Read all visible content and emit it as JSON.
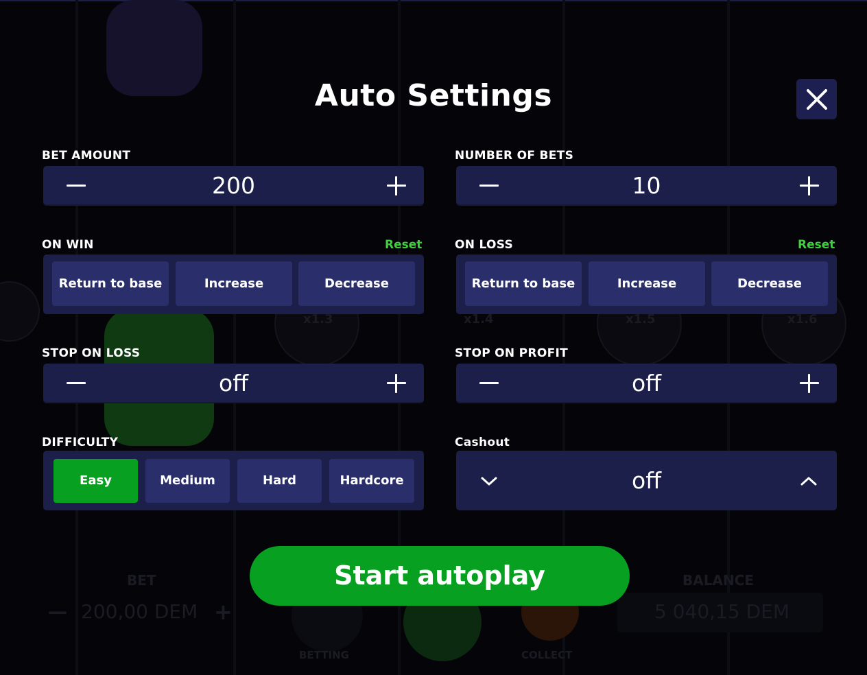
{
  "title": "Auto Settings",
  "bet_amount": {
    "label": "BET AMOUNT",
    "value": "200"
  },
  "number_of_bets": {
    "label": "NUMBER OF BETS",
    "value": "10"
  },
  "on_win": {
    "label": "ON WIN",
    "reset": "Reset",
    "options": [
      "Return to base",
      "Increase",
      "Decrease"
    ]
  },
  "on_loss": {
    "label": "ON LOSS",
    "reset": "Reset",
    "options": [
      "Return to base",
      "Increase",
      "Decrease"
    ]
  },
  "stop_on_loss": {
    "label": "STOP ON LOSS",
    "value": "off"
  },
  "stop_on_profit": {
    "label": "STOP ON PROFIT",
    "value": "off"
  },
  "difficulty": {
    "label": "DIFFICULTY",
    "options": [
      "Easy",
      "Medium",
      "Hard",
      "Hardcore"
    ],
    "selected": "Easy"
  },
  "cashout": {
    "label": "Cashout",
    "value": "off"
  },
  "start_button": "Start autoplay",
  "background": {
    "bet_label": "BET",
    "bet_value": "200,00 DEM",
    "balance_label": "BALANCE",
    "balance_value": "5 040,15 DEM",
    "betting_label": "BETTING",
    "collect_label": "COLLECT",
    "multipliers": [
      "x1.3",
      "x1.4",
      "x1.5",
      "x1.6"
    ]
  },
  "colors": {
    "panel": "#1c1f4a",
    "option": "#2a2f6c",
    "accent_green": "#08a021",
    "reset_green": "#3dd13a"
  }
}
